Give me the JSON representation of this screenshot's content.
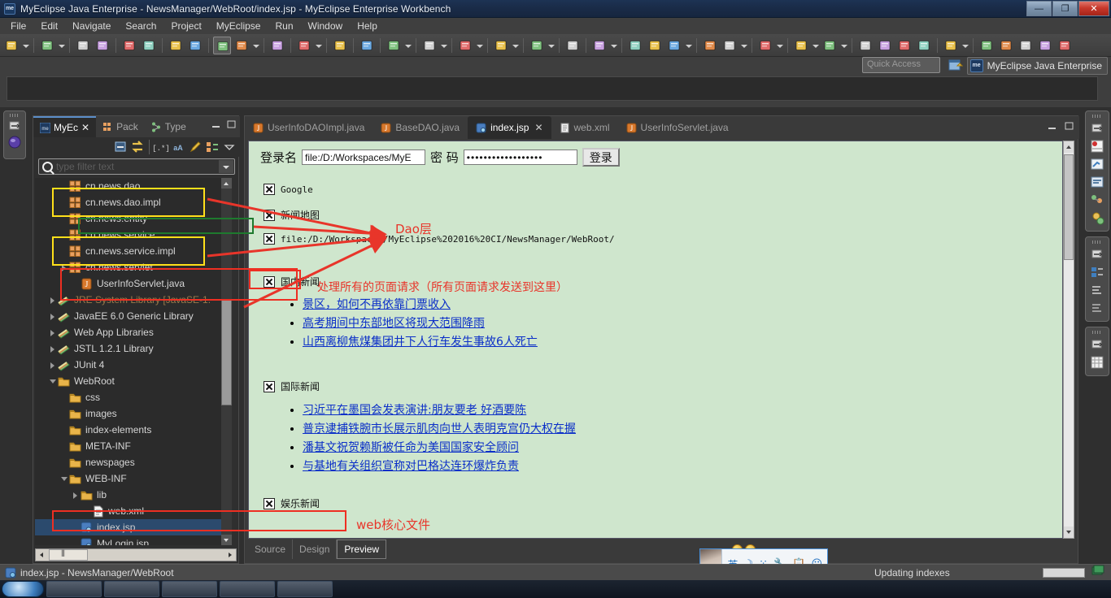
{
  "window": {
    "title": "MyEclipse Java Enterprise - NewsManager/WebRoot/index.jsp - MyEclipse Enterprise Workbench",
    "logo_text": "me",
    "minimize_label": "—",
    "maximize_label": "❐",
    "close_label": "✕"
  },
  "menubar": {
    "items": [
      {
        "label": "File"
      },
      {
        "label": "Edit"
      },
      {
        "label": "Navigate"
      },
      {
        "label": "Search"
      },
      {
        "label": "Project"
      },
      {
        "label": "MyEclipse"
      },
      {
        "label": "Run"
      },
      {
        "label": "Window"
      },
      {
        "label": "Help"
      }
    ]
  },
  "toolbar": {
    "quick_access_placeholder": "Quick Access",
    "perspective_label": "MyEclipse Java Enterprise",
    "perspective_badge": "me",
    "buttons": [
      {
        "name": "new-wizard-icon"
      },
      {
        "name": "new-dropdown-icon"
      },
      {
        "name": "new-java-project-icon"
      },
      {
        "name": "new-dropdown2-icon"
      },
      {
        "name": "save-icon"
      },
      {
        "name": "save-all-icon"
      },
      {
        "name": "print-icon"
      },
      {
        "name": "toggle-annotations-icon"
      },
      {
        "name": "undo-icon"
      },
      {
        "name": "redo-icon"
      },
      {
        "name": "deploy-icon"
      },
      {
        "name": "servers-icon"
      },
      {
        "name": "servers-dropdown-icon"
      },
      {
        "name": "open-browser-icon"
      },
      {
        "name": "database-explorer-icon"
      },
      {
        "name": "database-dropdown-icon"
      },
      {
        "name": "web-browser-icon"
      },
      {
        "name": "globe-icon"
      },
      {
        "name": "snapshot-icon"
      },
      {
        "name": "snapshot-dropdown-icon"
      },
      {
        "name": "external-tools-icon"
      },
      {
        "name": "external-dropdown-icon"
      },
      {
        "name": "run-icon"
      },
      {
        "name": "run-dropdown-icon"
      },
      {
        "name": "debug-icon"
      },
      {
        "name": "debug-dropdown-icon"
      },
      {
        "name": "profile-icon"
      },
      {
        "name": "profile-dropdown-icon"
      },
      {
        "name": "new-class-icon"
      },
      {
        "name": "refresh-icon"
      },
      {
        "name": "refresh-dropdown-icon"
      },
      {
        "name": "open-type-icon"
      },
      {
        "name": "open-resource-icon"
      },
      {
        "name": "edit-icon"
      },
      {
        "name": "edit-dropdown-icon"
      },
      {
        "name": "open-task-icon"
      },
      {
        "name": "next-annotation-icon"
      },
      {
        "name": "next-dropdown-icon"
      },
      {
        "name": "previous-edit-icon"
      },
      {
        "name": "prev-dropdown-icon"
      },
      {
        "name": "back-icon"
      },
      {
        "name": "back-dropdown-icon"
      },
      {
        "name": "forward-icon"
      },
      {
        "name": "forward-dropdown-icon"
      },
      {
        "name": "restore-layout-icon"
      },
      {
        "name": "split-editor-icon"
      },
      {
        "name": "preview-icon"
      },
      {
        "name": "outline-icon"
      },
      {
        "name": "people-icon"
      },
      {
        "name": "people-dropdown-icon"
      },
      {
        "name": "underline-icon"
      },
      {
        "name": "bold-icon"
      },
      {
        "name": "italic-icon"
      },
      {
        "name": "font-small-icon"
      },
      {
        "name": "font-large-icon"
      }
    ]
  },
  "explorer": {
    "tabs": [
      {
        "label": "MyEc",
        "icon": "myeclipse-icon",
        "active": true,
        "closable": true
      },
      {
        "label": "Pack",
        "icon": "package-explorer-icon",
        "active": false,
        "closable": false
      },
      {
        "label": "Type",
        "icon": "type-hierarchy-icon",
        "active": false,
        "closable": false
      }
    ],
    "filter_placeholder": "type filter text",
    "view_buttons": [
      {
        "name": "collapse-all-icon"
      },
      {
        "name": "link-with-editor-icon"
      },
      {
        "name": "regex-filter-icon"
      },
      {
        "name": "case-sensitive-icon"
      },
      {
        "name": "highlight-icon"
      },
      {
        "name": "customize-icon"
      },
      {
        "name": "view-menu-icon"
      }
    ],
    "tree": [
      {
        "label": "cn.news.dao",
        "icon": "package-icon",
        "indent": 2,
        "arrow": "none"
      },
      {
        "label": "cn.news.dao.impl",
        "icon": "package-icon",
        "indent": 2,
        "arrow": "none"
      },
      {
        "label": "cn.news.entity",
        "icon": "package-icon",
        "indent": 2,
        "arrow": "none"
      },
      {
        "label": "cn.news.service",
        "icon": "package-icon",
        "indent": 2,
        "arrow": "none"
      },
      {
        "label": "cn.news.service.impl",
        "icon": "package-icon",
        "indent": 2,
        "arrow": "none"
      },
      {
        "label": "cn.news.servlet",
        "icon": "package-icon",
        "indent": 2,
        "arrow": "open"
      },
      {
        "label": "UserInfoServlet.java",
        "icon": "java-file-icon",
        "indent": 3,
        "arrow": "none"
      },
      {
        "label": "JRE System Library [JavaSE-1.",
        "icon": "library-icon",
        "indent": 1,
        "arrow": "open",
        "muted": true
      },
      {
        "label": "JavaEE 6.0 Generic Library",
        "icon": "library-icon",
        "indent": 1,
        "arrow": "open"
      },
      {
        "label": "Web App Libraries",
        "icon": "library-icon",
        "indent": 1,
        "arrow": "open"
      },
      {
        "label": "JSTL 1.2.1 Library",
        "icon": "library-icon",
        "indent": 1,
        "arrow": "open"
      },
      {
        "label": "JUnit 4",
        "icon": "library-icon",
        "indent": 1,
        "arrow": "open"
      },
      {
        "label": "WebRoot",
        "icon": "folder-icon",
        "indent": 1,
        "arrow": "expanded"
      },
      {
        "label": "css",
        "icon": "folder-icon",
        "indent": 2,
        "arrow": "none"
      },
      {
        "label": "images",
        "icon": "folder-icon",
        "indent": 2,
        "arrow": "none"
      },
      {
        "label": "index-elements",
        "icon": "folder-icon",
        "indent": 2,
        "arrow": "none"
      },
      {
        "label": "META-INF",
        "icon": "folder-icon",
        "indent": 2,
        "arrow": "none"
      },
      {
        "label": "newspages",
        "icon": "folder-icon",
        "indent": 2,
        "arrow": "none"
      },
      {
        "label": "WEB-INF",
        "icon": "folder-icon",
        "indent": 2,
        "arrow": "expanded"
      },
      {
        "label": "lib",
        "icon": "folder-icon",
        "indent": 3,
        "arrow": "open"
      },
      {
        "label": "web.xml",
        "icon": "xml-file-icon",
        "indent": 4,
        "arrow": "none"
      },
      {
        "label": "index.jsp",
        "icon": "jsp-file-icon",
        "indent": 3,
        "arrow": "none",
        "selected": true
      },
      {
        "label": "MyLogin.jsp",
        "icon": "jsp-file-icon",
        "indent": 3,
        "arrow": "none"
      }
    ]
  },
  "editor": {
    "tabs": [
      {
        "label": "UserInfoDAOImpl.java",
        "icon": "java-file-icon",
        "active": false
      },
      {
        "label": "BaseDAO.java",
        "icon": "java-file-icon",
        "active": false
      },
      {
        "label": "index.jsp",
        "icon": "jsp-file-icon",
        "active": true,
        "close": "✕"
      },
      {
        "label": "web.xml",
        "icon": "xml-file-icon",
        "active": false
      },
      {
        "label": "UserInfoServlet.java",
        "icon": "java-file-icon",
        "active": false
      }
    ],
    "bottom_tabs": [
      {
        "label": "Source",
        "active": false
      },
      {
        "label": "Design",
        "active": false
      },
      {
        "label": "Preview",
        "active": true
      }
    ]
  },
  "preview": {
    "login": {
      "name_label": "登录名",
      "name_value": "file:/D:/Workspaces/MyE",
      "password_label": "密 码",
      "password_value": "••••••••••••••••••",
      "submit_label": "登录"
    },
    "broken_items": [
      {
        "text": "Google",
        "style": "mono"
      },
      {
        "text": "新闻地图",
        "style": "cn"
      },
      {
        "text": "file:/D:/Workspaces/MyEclipse%202016%20CI/NewsManager/WebRoot/",
        "style": "mono"
      }
    ],
    "section_domestic": {
      "heading": "国内新闻",
      "links": [
        "景区，如何不再依靠门票收入",
        "高考期间中东部地区将现大范围降雨",
        "山西离柳焦煤集团井下人行车发生事故6人死亡"
      ]
    },
    "section_international": {
      "heading": "国际新闻",
      "links": [
        "习近平在墨国会发表演讲:朋友要老 好酒要陈",
        "普京逮捕铁腕市长展示肌肉向世人表明克宫仍大权在握",
        "潘基文祝贺赖斯被任命为美国国家安全顾问",
        "与基地有关组织宣称对巴格达连环爆炸负责"
      ]
    },
    "section_entertainment": {
      "heading": "娱乐新闻"
    }
  },
  "annotations": [
    {
      "id": "dao-layer",
      "text": "Dao层",
      "color": "#e8352a"
    },
    {
      "id": "servlet-note",
      "text": "处理所有的页面请求（所有页面请求发送到这里）",
      "color": "#e8352a"
    },
    {
      "id": "webxml-note",
      "text": "web核心文件",
      "color": "#e8352a"
    }
  ],
  "statusbar": {
    "text": "index.jsp - NewsManager/WebRoot",
    "icon": "jsp-file-icon",
    "right_text": "Updating indexes"
  },
  "ime": {
    "items": [
      "英",
      "☽",
      "⁙",
      "🔧",
      "📋",
      "☺"
    ]
  },
  "colors": {
    "accent": "#5b8ec9",
    "annotation_red": "#e8352a",
    "highlight_yellow": "#ffe01a",
    "highlight_green": "#1e7a2e",
    "link_blue": "#0b2fc8",
    "preview_bg": "#cfe6cd",
    "chrome_bg": "#3f3f3f"
  }
}
